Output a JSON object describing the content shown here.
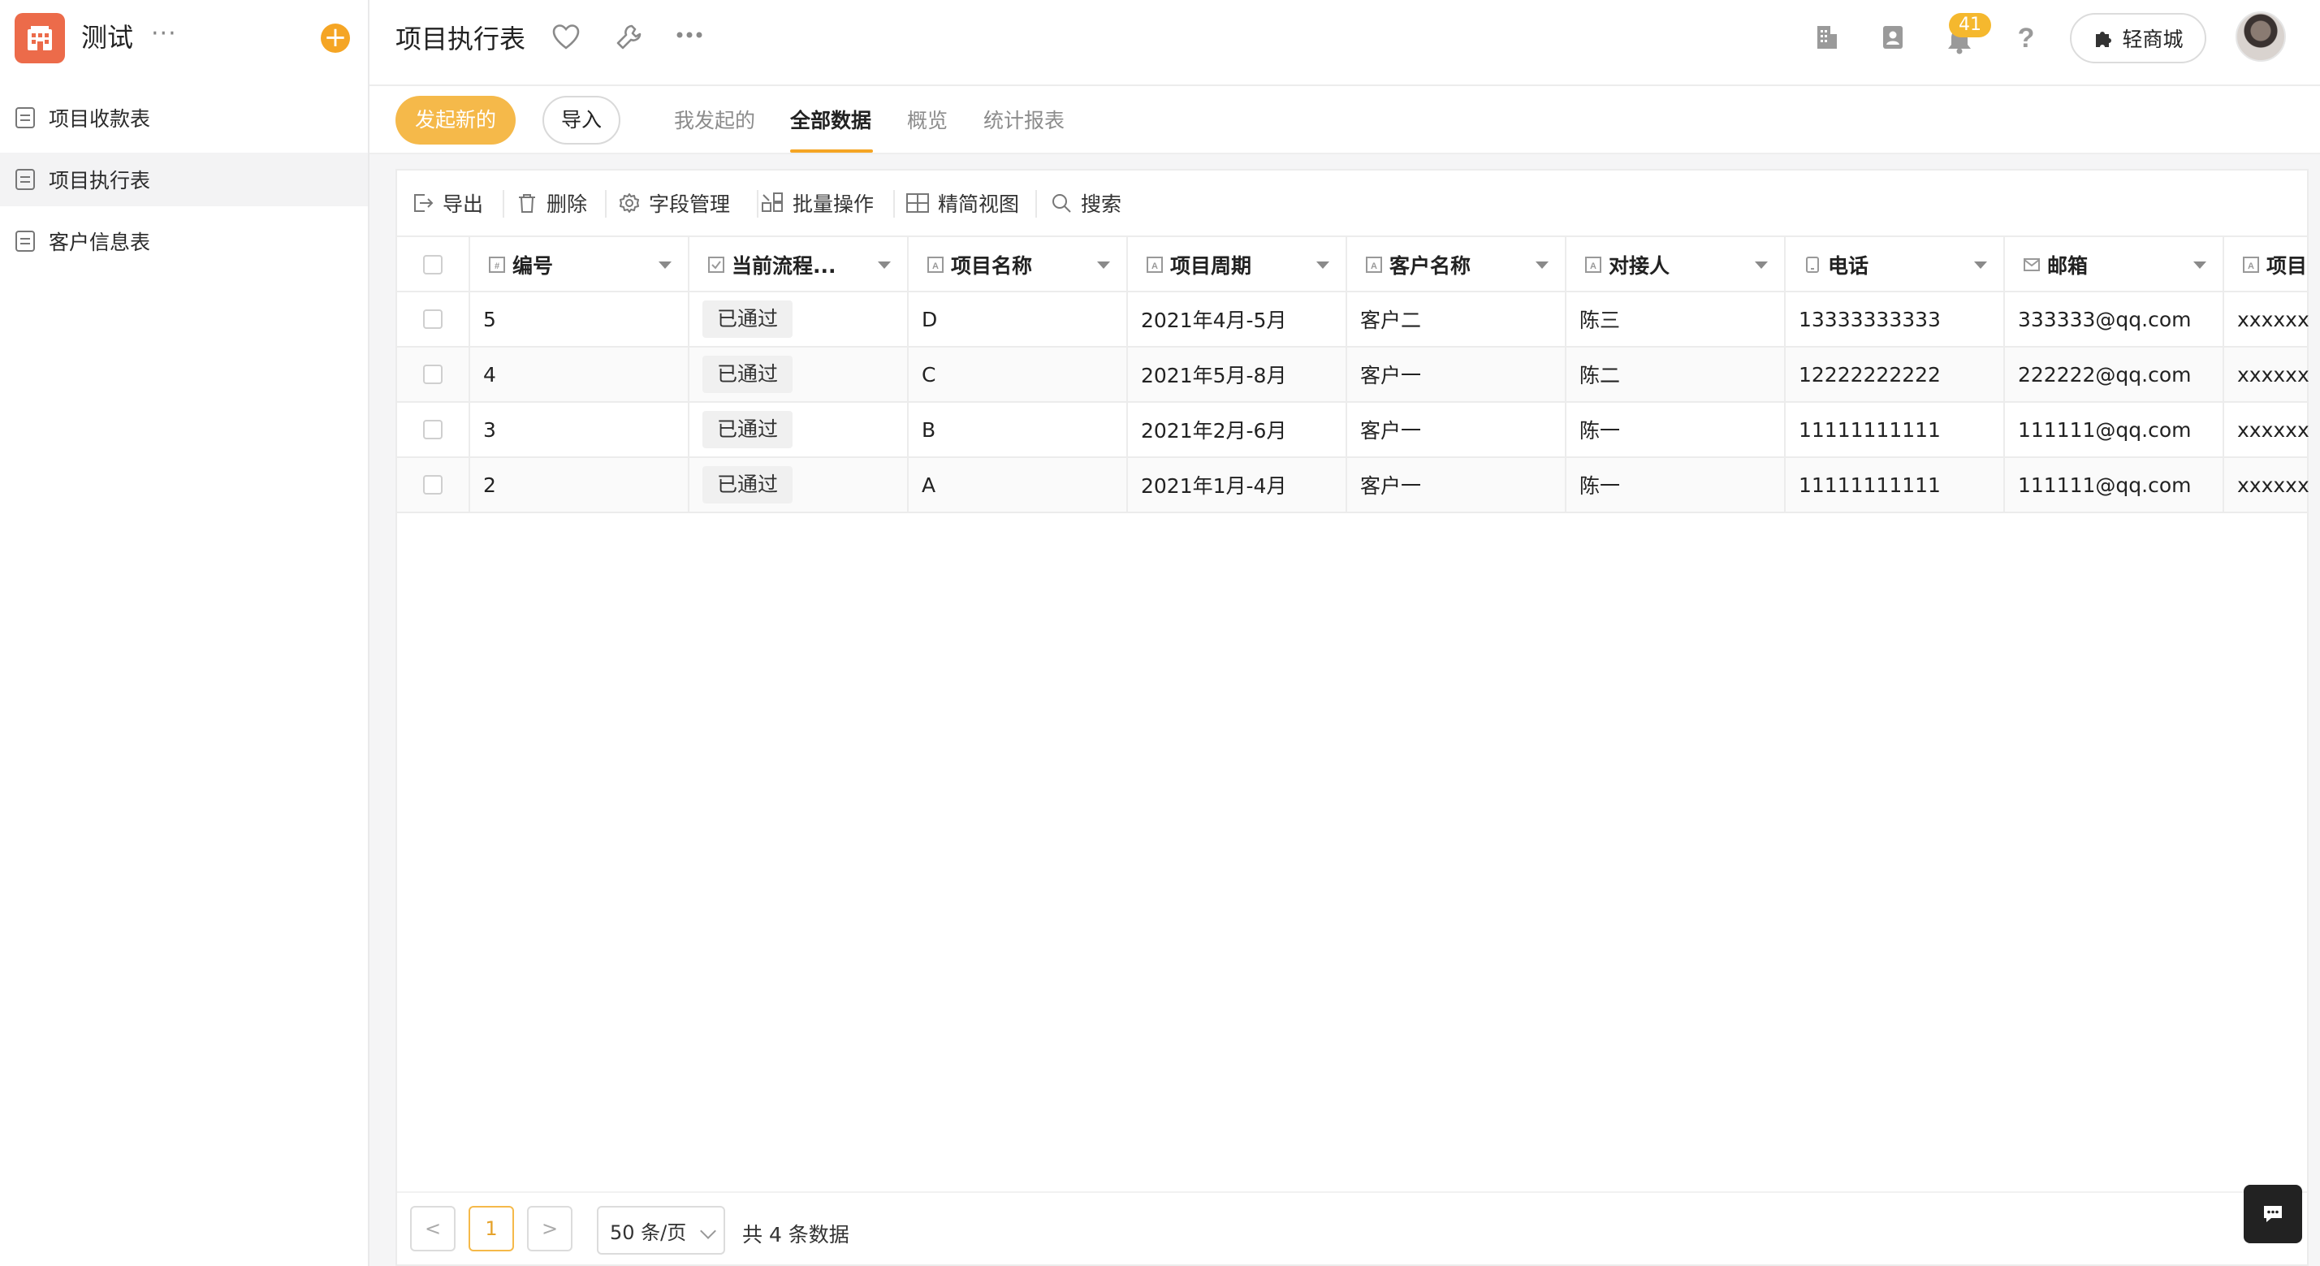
{
  "colors": {
    "accent": "#f5a524",
    "logo": "#ec6b4a",
    "badge": "#f5b82e"
  },
  "app": {
    "title": "测试",
    "more": "···",
    "add": "+"
  },
  "sidebar": {
    "items": [
      {
        "label": "项目收款表",
        "icon": "form-icon"
      },
      {
        "label": "项目执行表",
        "icon": "form-icon",
        "active": true
      },
      {
        "label": "客户信息表",
        "icon": "form-icon"
      }
    ]
  },
  "header": {
    "title": "项目执行表",
    "notification_count": "41",
    "market_label": "轻商城",
    "icons": [
      "heart-icon",
      "wrench-icon",
      "more-icon",
      "building-icon",
      "contacts-icon",
      "bell-icon",
      "help-icon"
    ]
  },
  "subnav": {
    "primary_button": "发起新的",
    "import_button": "导入",
    "tabs": [
      "我发起的",
      "全部数据",
      "概览",
      "统计报表"
    ],
    "active_tab": "全部数据"
  },
  "toolbar": {
    "export": "导出",
    "delete": "删除",
    "fields": "字段管理",
    "batch": "批量操作",
    "view": "精简视图",
    "search": "搜索"
  },
  "table": {
    "columns": [
      "编号",
      "当前流程...",
      "项目名称",
      "项目周期",
      "客户名称",
      "对接人",
      "电话",
      "邮箱",
      "项目"
    ],
    "rows": [
      [
        "5",
        "已通过",
        "D",
        "2021年4月-5月",
        "客户二",
        "陈三",
        "13333333333",
        "333333@qq.com",
        "xxxxxxx"
      ],
      [
        "4",
        "已通过",
        "C",
        "2021年5月-8月",
        "客户一",
        "陈二",
        "12222222222",
        "222222@qq.com",
        "xxxxxxx"
      ],
      [
        "3",
        "已通过",
        "B",
        "2021年2月-6月",
        "客户一",
        "陈一",
        "11111111111",
        "111111@qq.com",
        "xxxxxxx"
      ],
      [
        "2",
        "已通过",
        "A",
        "2021年1月-4月",
        "客户一",
        "陈一",
        "11111111111",
        "111111@qq.com",
        "xxxxxxx"
      ]
    ]
  },
  "pagination": {
    "prev": "<",
    "current_page": "1",
    "next": ">",
    "page_size": "50 条/页",
    "total": "共 4 条数据"
  }
}
